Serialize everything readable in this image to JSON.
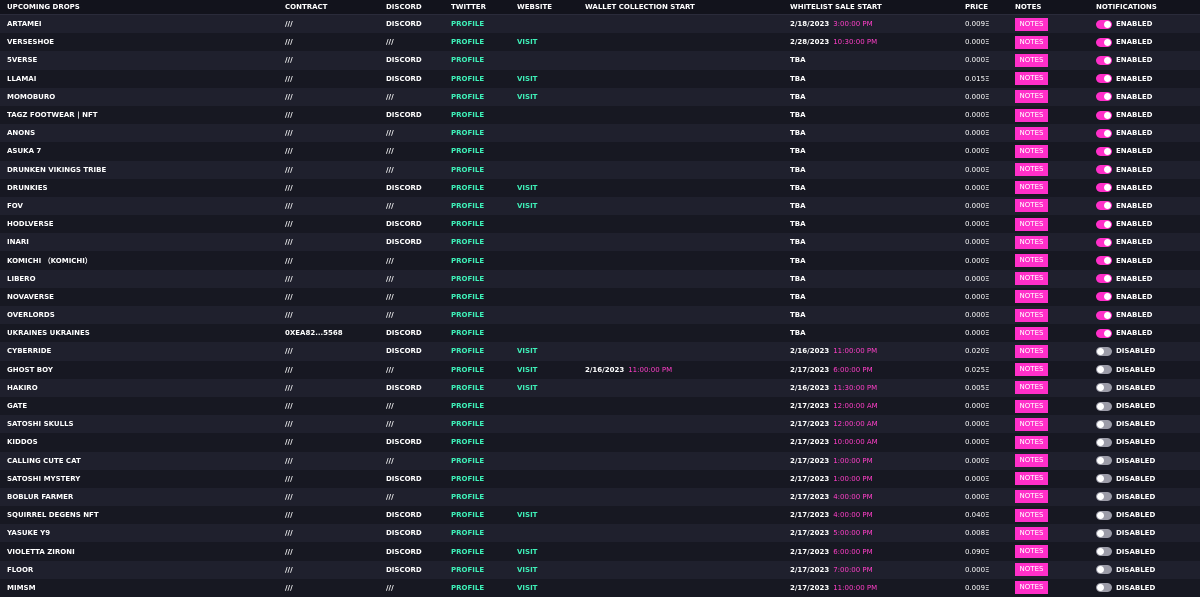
{
  "headers": {
    "name": "UPCOMING DROPS",
    "contract": "CONTRACT",
    "discord": "DISCORD",
    "twitter": "TWITTER",
    "website": "WEBSITE",
    "wallet": "WALLET COLLECTION START",
    "whitelist": "WHITELIST SALE START",
    "price": "PRICE",
    "notes": "NOTES",
    "notifications": "NOTIFICATIONS"
  },
  "colors": {
    "accent": "#ff2fc9",
    "link": "#3ef0b8",
    "background": "#1b1c28"
  },
  "notes_label": "NOTES",
  "rows": [
    {
      "name": "ARTAMEI",
      "contract": "///",
      "discord": "DISCORD",
      "twitter": "PROFILE",
      "website": "",
      "wallet_date": "",
      "wallet_time": "",
      "wl_date": "2/18/2023",
      "wl_time": "3:00:00 PM",
      "price": "0.009Ξ",
      "notif": "ENABLED",
      "on": true
    },
    {
      "name": "VERSESHOE",
      "contract": "///",
      "discord": "///",
      "twitter": "PROFILE",
      "website": "VISIT",
      "wallet_date": "",
      "wallet_time": "",
      "wl_date": "2/28/2023",
      "wl_time": "10:30:00 PM",
      "price": "0.000Ξ",
      "notif": "ENABLED",
      "on": true
    },
    {
      "name": "5VERSE",
      "contract": "///",
      "discord": "DISCORD",
      "twitter": "PROFILE",
      "website": "",
      "wallet_date": "",
      "wallet_time": "",
      "wl_date": "TBA",
      "wl_time": "",
      "price": "0.000Ξ",
      "notif": "ENABLED",
      "on": true
    },
    {
      "name": "LLAMAI",
      "contract": "///",
      "discord": "DISCORD",
      "twitter": "PROFILE",
      "website": "VISIT",
      "wallet_date": "",
      "wallet_time": "",
      "wl_date": "TBA",
      "wl_time": "",
      "price": "0.015Ξ",
      "notif": "ENABLED",
      "on": true
    },
    {
      "name": "MOMOBURO",
      "contract": "///",
      "discord": "///",
      "twitter": "PROFILE",
      "website": "VISIT",
      "wallet_date": "",
      "wallet_time": "",
      "wl_date": "TBA",
      "wl_time": "",
      "price": "0.000Ξ",
      "notif": "ENABLED",
      "on": true
    },
    {
      "name": "TAGZ FOOTWEAR | NFT",
      "contract": "///",
      "discord": "DISCORD",
      "twitter": "PROFILE",
      "website": "",
      "wallet_date": "",
      "wallet_time": "",
      "wl_date": "TBA",
      "wl_time": "",
      "price": "0.000Ξ",
      "notif": "ENABLED",
      "on": true
    },
    {
      "name": "ANONS",
      "contract": "///",
      "discord": "///",
      "twitter": "PROFILE",
      "website": "",
      "wallet_date": "",
      "wallet_time": "",
      "wl_date": "TBA",
      "wl_time": "",
      "price": "0.000Ξ",
      "notif": "ENABLED",
      "on": true
    },
    {
      "name": "ASUKA 7",
      "contract": "///",
      "discord": "///",
      "twitter": "PROFILE",
      "website": "",
      "wallet_date": "",
      "wallet_time": "",
      "wl_date": "TBA",
      "wl_time": "",
      "price": "0.000Ξ",
      "notif": "ENABLED",
      "on": true
    },
    {
      "name": "DRUNKEN VIKINGS TRIBE",
      "contract": "///",
      "discord": "///",
      "twitter": "PROFILE",
      "website": "",
      "wallet_date": "",
      "wallet_time": "",
      "wl_date": "TBA",
      "wl_time": "",
      "price": "0.000Ξ",
      "notif": "ENABLED",
      "on": true
    },
    {
      "name": "DRUNKIES",
      "contract": "///",
      "discord": "DISCORD",
      "twitter": "PROFILE",
      "website": "VISIT",
      "wallet_date": "",
      "wallet_time": "",
      "wl_date": "TBA",
      "wl_time": "",
      "price": "0.000Ξ",
      "notif": "ENABLED",
      "on": true
    },
    {
      "name": "FOV",
      "contract": "///",
      "discord": "///",
      "twitter": "PROFILE",
      "website": "VISIT",
      "wallet_date": "",
      "wallet_time": "",
      "wl_date": "TBA",
      "wl_time": "",
      "price": "0.000Ξ",
      "notif": "ENABLED",
      "on": true
    },
    {
      "name": "HODLVERSE",
      "contract": "///",
      "discord": "DISCORD",
      "twitter": "PROFILE",
      "website": "",
      "wallet_date": "",
      "wallet_time": "",
      "wl_date": "TBA",
      "wl_time": "",
      "price": "0.000Ξ",
      "notif": "ENABLED",
      "on": true
    },
    {
      "name": "INARI",
      "contract": "///",
      "discord": "DISCORD",
      "twitter": "PROFILE",
      "website": "",
      "wallet_date": "",
      "wallet_time": "",
      "wl_date": "TBA",
      "wl_time": "",
      "price": "0.000Ξ",
      "notif": "ENABLED",
      "on": true
    },
    {
      "name": "KOMICHI （KOMICHI）",
      "contract": "///",
      "discord": "///",
      "twitter": "PROFILE",
      "website": "",
      "wallet_date": "",
      "wallet_time": "",
      "wl_date": "TBA",
      "wl_time": "",
      "price": "0.000Ξ",
      "notif": "ENABLED",
      "on": true
    },
    {
      "name": "LIBERO",
      "contract": "///",
      "discord": "///",
      "twitter": "PROFILE",
      "website": "",
      "wallet_date": "",
      "wallet_time": "",
      "wl_date": "TBA",
      "wl_time": "",
      "price": "0.000Ξ",
      "notif": "ENABLED",
      "on": true
    },
    {
      "name": "NOVAVERSE",
      "contract": "///",
      "discord": "///",
      "twitter": "PROFILE",
      "website": "",
      "wallet_date": "",
      "wallet_time": "",
      "wl_date": "TBA",
      "wl_time": "",
      "price": "0.000Ξ",
      "notif": "ENABLED",
      "on": true
    },
    {
      "name": "OVERLORDS",
      "contract": "///",
      "discord": "///",
      "twitter": "PROFILE",
      "website": "",
      "wallet_date": "",
      "wallet_time": "",
      "wl_date": "TBA",
      "wl_time": "",
      "price": "0.000Ξ",
      "notif": "ENABLED",
      "on": true
    },
    {
      "name": "UKRAINES UKRAINES",
      "contract": "0XEA82...5568",
      "discord": "DISCORD",
      "twitter": "PROFILE",
      "website": "",
      "wallet_date": "",
      "wallet_time": "",
      "wl_date": "TBA",
      "wl_time": "",
      "price": "0.000Ξ",
      "notif": "ENABLED",
      "on": true
    },
    {
      "name": "CYBERRIDE",
      "contract": "///",
      "discord": "DISCORD",
      "twitter": "PROFILE",
      "website": "VISIT",
      "wallet_date": "",
      "wallet_time": "",
      "wl_date": "2/16/2023",
      "wl_time": "11:00:00 PM",
      "price": "0.020Ξ",
      "notif": "DISABLED",
      "on": false
    },
    {
      "name": "GHOST BOY",
      "contract": "///",
      "discord": "///",
      "twitter": "PROFILE",
      "website": "VISIT",
      "wallet_date": "2/16/2023",
      "wallet_time": "11:00:00 PM",
      "wl_date": "2/17/2023",
      "wl_time": "6:00:00 PM",
      "price": "0.025Ξ",
      "notif": "DISABLED",
      "on": false
    },
    {
      "name": "HAKIRO",
      "contract": "///",
      "discord": "DISCORD",
      "twitter": "PROFILE",
      "website": "VISIT",
      "wallet_date": "",
      "wallet_time": "",
      "wl_date": "2/16/2023",
      "wl_time": "11:30:00 PM",
      "price": "0.005Ξ",
      "notif": "DISABLED",
      "on": false
    },
    {
      "name": "GATE",
      "contract": "///",
      "discord": "///",
      "twitter": "PROFILE",
      "website": "",
      "wallet_date": "",
      "wallet_time": "",
      "wl_date": "2/17/2023",
      "wl_time": "12:00:00 AM",
      "price": "0.000Ξ",
      "notif": "DISABLED",
      "on": false
    },
    {
      "name": "SATOSHI SKULLS",
      "contract": "///",
      "discord": "///",
      "twitter": "PROFILE",
      "website": "",
      "wallet_date": "",
      "wallet_time": "",
      "wl_date": "2/17/2023",
      "wl_time": "12:00:00 AM",
      "price": "0.000Ξ",
      "notif": "DISABLED",
      "on": false
    },
    {
      "name": "KIDDOS",
      "contract": "///",
      "discord": "DISCORD",
      "twitter": "PROFILE",
      "website": "",
      "wallet_date": "",
      "wallet_time": "",
      "wl_date": "2/17/2023",
      "wl_time": "10:00:00 AM",
      "price": "0.000Ξ",
      "notif": "DISABLED",
      "on": false
    },
    {
      "name": "CALLING CUTE CAT",
      "contract": "///",
      "discord": "///",
      "twitter": "PROFILE",
      "website": "",
      "wallet_date": "",
      "wallet_time": "",
      "wl_date": "2/17/2023",
      "wl_time": "1:00:00 PM",
      "price": "0.000Ξ",
      "notif": "DISABLED",
      "on": false
    },
    {
      "name": "SATOSHI MYSTERY",
      "contract": "///",
      "discord": "DISCORD",
      "twitter": "PROFILE",
      "website": "",
      "wallet_date": "",
      "wallet_time": "",
      "wl_date": "2/17/2023",
      "wl_time": "1:00:00 PM",
      "price": "0.000Ξ",
      "notif": "DISABLED",
      "on": false
    },
    {
      "name": "BOBLUR FARMER",
      "contract": "///",
      "discord": "///",
      "twitter": "PROFILE",
      "website": "",
      "wallet_date": "",
      "wallet_time": "",
      "wl_date": "2/17/2023",
      "wl_time": "4:00:00 PM",
      "price": "0.000Ξ",
      "notif": "DISABLED",
      "on": false
    },
    {
      "name": "SQUIRREL DEGENS NFT",
      "contract": "///",
      "discord": "DISCORD",
      "twitter": "PROFILE",
      "website": "VISIT",
      "wallet_date": "",
      "wallet_time": "",
      "wl_date": "2/17/2023",
      "wl_time": "4:00:00 PM",
      "price": "0.040Ξ",
      "notif": "DISABLED",
      "on": false
    },
    {
      "name": "YASUKE Y9",
      "contract": "///",
      "discord": "DISCORD",
      "twitter": "PROFILE",
      "website": "",
      "wallet_date": "",
      "wallet_time": "",
      "wl_date": "2/17/2023",
      "wl_time": "5:00:00 PM",
      "price": "0.008Ξ",
      "notif": "DISABLED",
      "on": false
    },
    {
      "name": "VIOLETTA ZIRONI",
      "contract": "///",
      "discord": "DISCORD",
      "twitter": "PROFILE",
      "website": "VISIT",
      "wallet_date": "",
      "wallet_time": "",
      "wl_date": "2/17/2023",
      "wl_time": "6:00:00 PM",
      "price": "0.090Ξ",
      "notif": "DISABLED",
      "on": false
    },
    {
      "name": "FLOOR",
      "contract": "///",
      "discord": "DISCORD",
      "twitter": "PROFILE",
      "website": "VISIT",
      "wallet_date": "",
      "wallet_time": "",
      "wl_date": "2/17/2023",
      "wl_time": "7:00:00 PM",
      "price": "0.000Ξ",
      "notif": "DISABLED",
      "on": false
    },
    {
      "name": "MIMSM",
      "contract": "///",
      "discord": "///",
      "twitter": "PROFILE",
      "website": "VISIT",
      "wallet_date": "",
      "wallet_time": "",
      "wl_date": "2/17/2023",
      "wl_time": "11:00:00 PM",
      "price": "0.009Ξ",
      "notif": "DISABLED",
      "on": false
    }
  ]
}
